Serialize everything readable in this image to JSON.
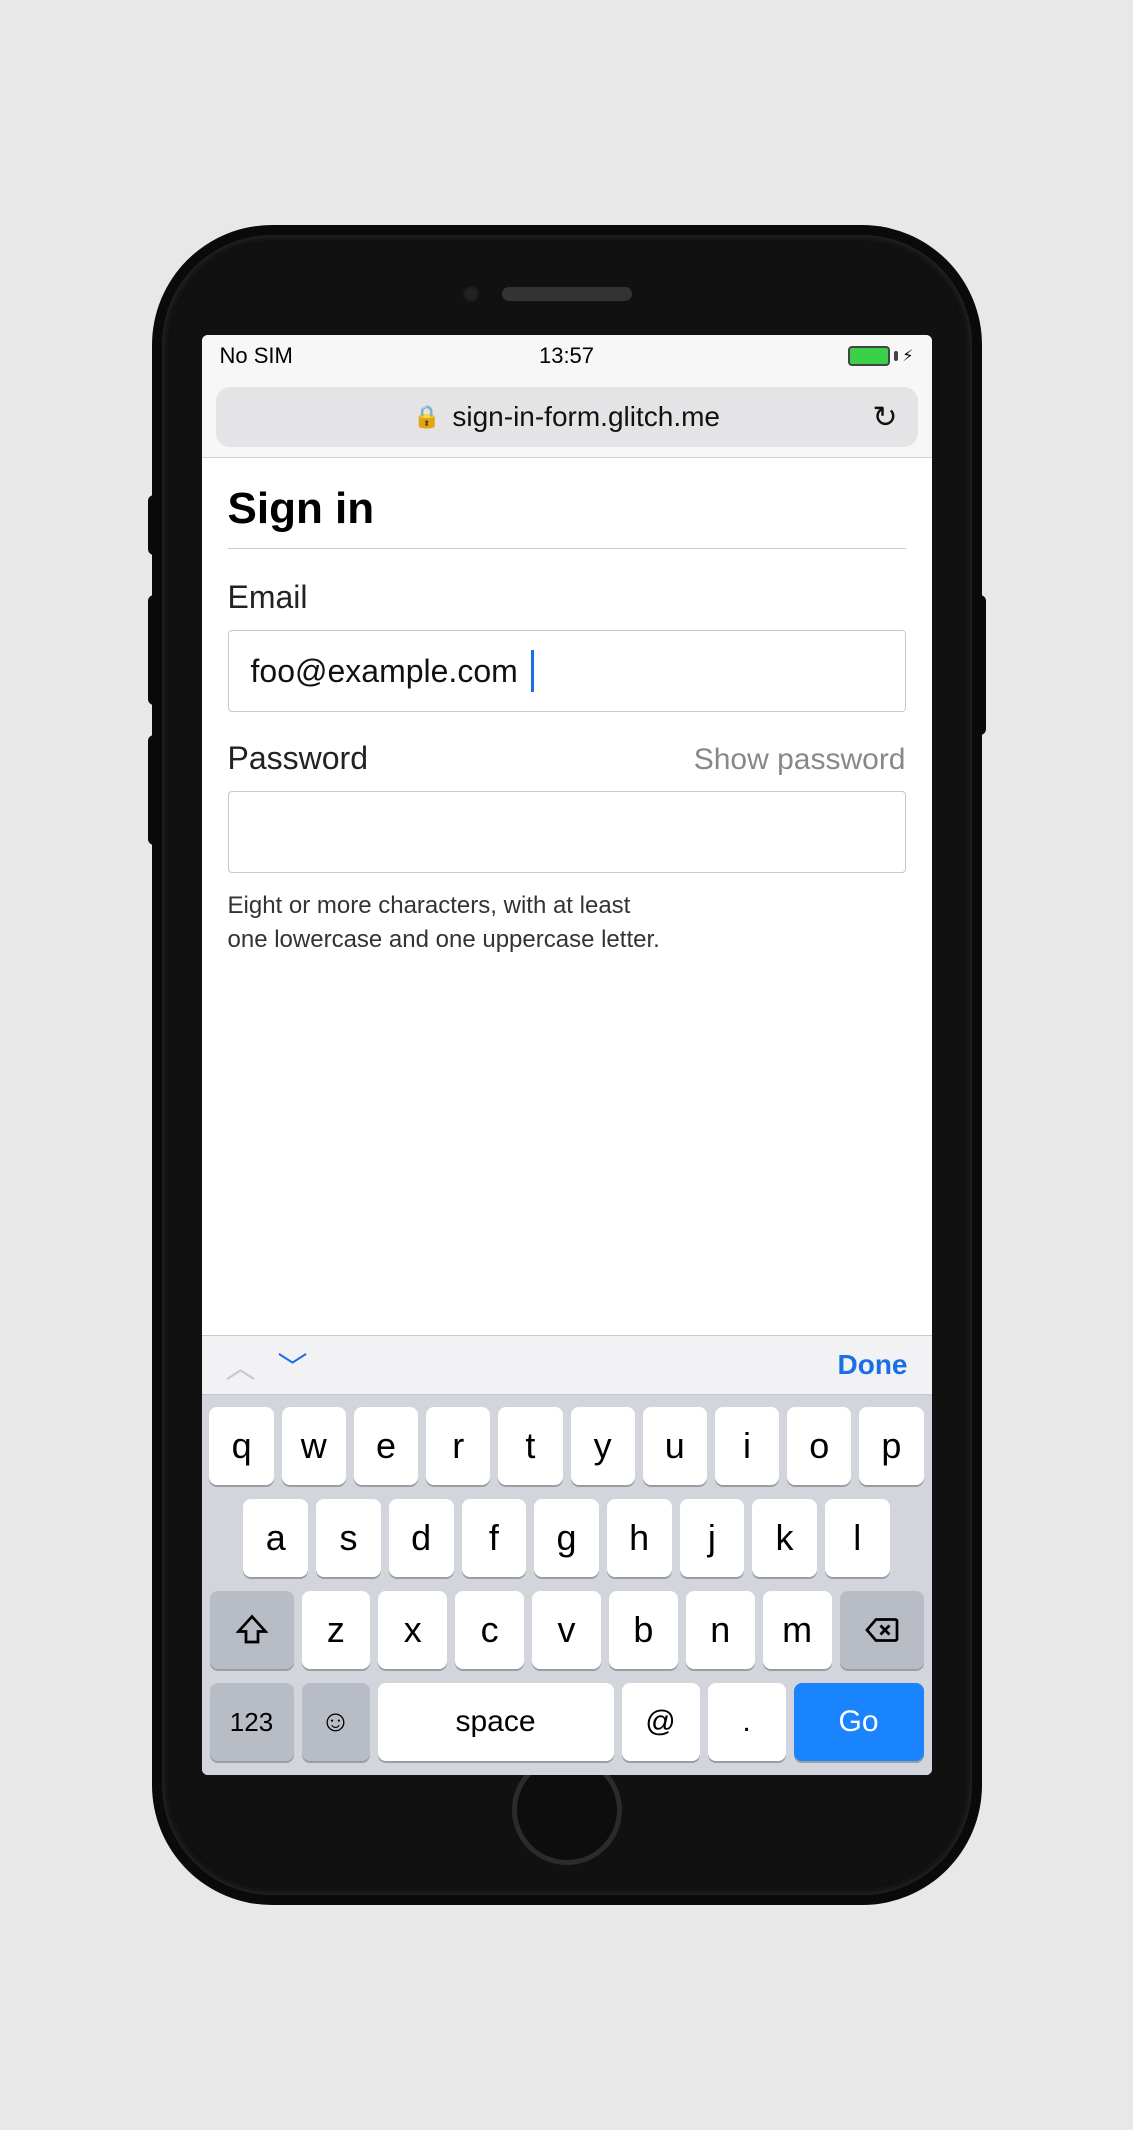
{
  "status": {
    "carrier": "No SIM",
    "time": "13:57"
  },
  "urlbar": {
    "domain": "sign-in-form.glitch.me"
  },
  "page": {
    "title": "Sign in",
    "email_label": "Email",
    "email_value": "foo@example.com",
    "password_label": "Password",
    "show_password": "Show password",
    "password_value": "",
    "hint_line1": "Eight or more characters, with at least",
    "hint_line2": "one lowercase and one uppercase letter."
  },
  "accessory": {
    "done": "Done"
  },
  "keyboard": {
    "row1": [
      "q",
      "w",
      "e",
      "r",
      "t",
      "y",
      "u",
      "i",
      "o",
      "p"
    ],
    "row2": [
      "a",
      "s",
      "d",
      "f",
      "g",
      "h",
      "j",
      "k",
      "l"
    ],
    "row3": [
      "z",
      "x",
      "c",
      "v",
      "b",
      "n",
      "m"
    ],
    "numkey": "123",
    "space": "space",
    "at": "@",
    "dot": ".",
    "go": "Go"
  }
}
